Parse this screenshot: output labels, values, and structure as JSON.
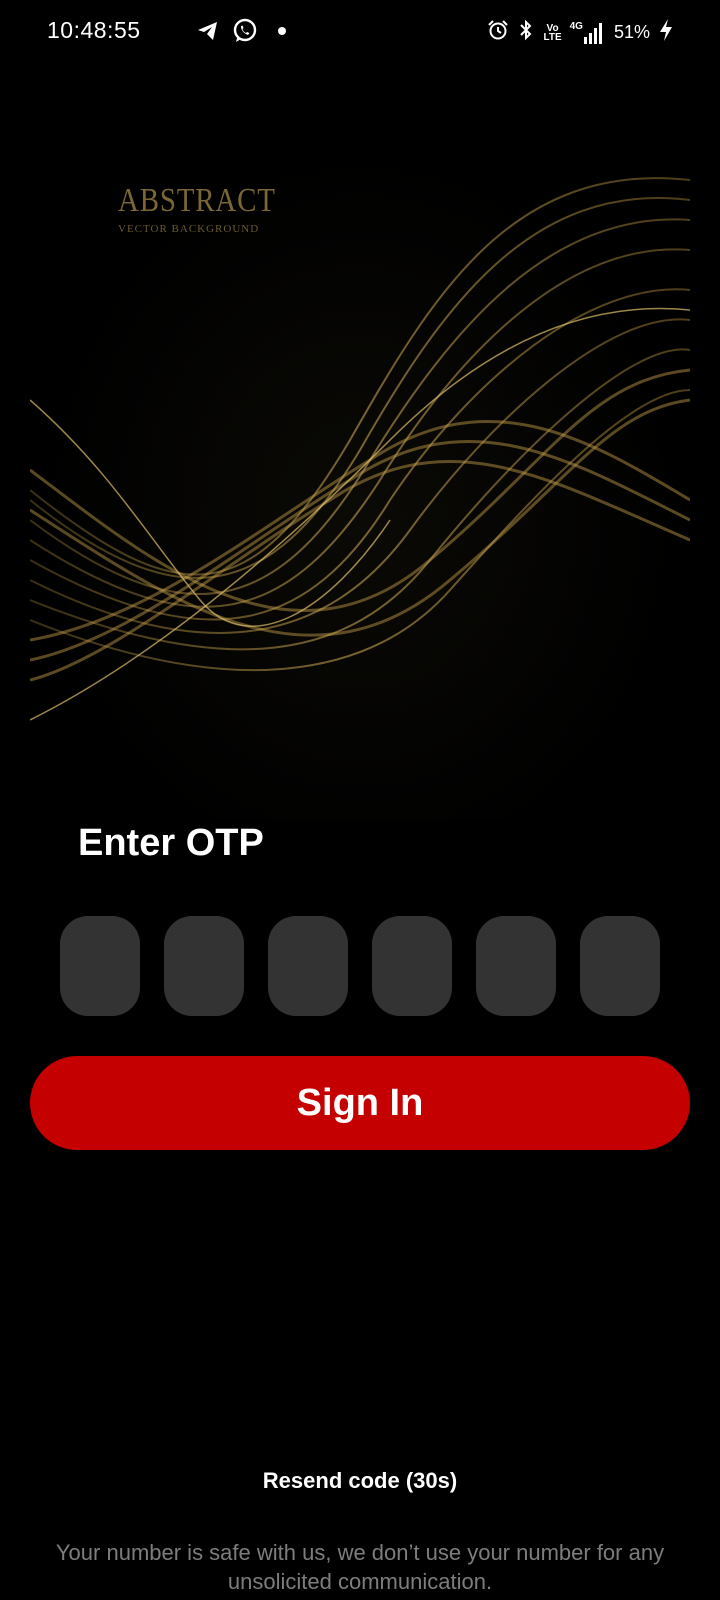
{
  "status_bar": {
    "time": "10:48:55",
    "battery": "51%",
    "network": "4G",
    "volte_top": "Vo",
    "volte_bottom": "LTE",
    "icons_left": [
      "telegram-icon",
      "whatsapp-icon",
      "notification-dot-icon"
    ],
    "icons_right": [
      "alarm-icon",
      "bluetooth-icon",
      "volte-icon",
      "signal-icon",
      "battery-charging-icon"
    ]
  },
  "hero": {
    "title": "ABSTRACT",
    "subtitle": "VECTOR BACKGROUND",
    "accent_color": "#c9a24a"
  },
  "otp": {
    "heading": "Enter OTP",
    "digit_count": 6,
    "digits": [
      "",
      "",
      "",
      "",
      "",
      ""
    ],
    "box_color": "#333333"
  },
  "actions": {
    "signin_label": "Sign In",
    "signin_color": "#c40000",
    "resend_label": "Resend code (30s)"
  },
  "footer": {
    "privacy_text": "Your number is safe with us, we don’t use your number for any unsolicited communication."
  }
}
